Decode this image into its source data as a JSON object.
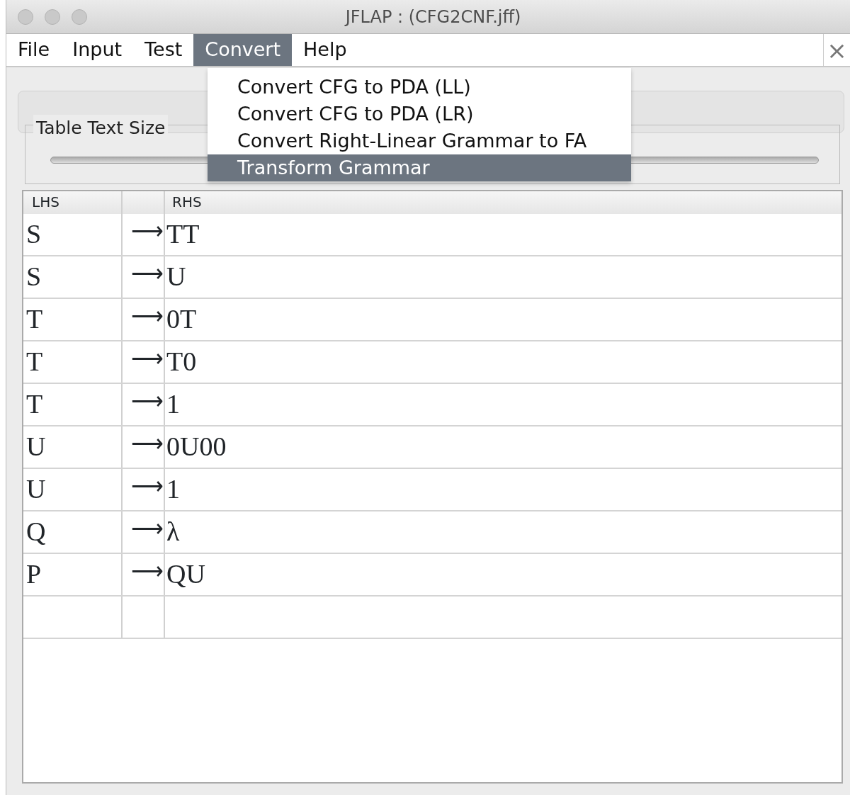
{
  "window": {
    "title": "JFLAP : (CFG2CNF.jff)"
  },
  "menubar": [
    {
      "label": "File",
      "selected": false
    },
    {
      "label": "Input",
      "selected": false
    },
    {
      "label": "Test",
      "selected": false
    },
    {
      "label": "Convert",
      "selected": true
    },
    {
      "label": "Help",
      "selected": false
    }
  ],
  "close_button": "×",
  "dropdown": [
    {
      "label": "Convert CFG to PDA (LL)",
      "selected": false
    },
    {
      "label": "Convert CFG to PDA (LR)",
      "selected": false
    },
    {
      "label": "Convert Right-Linear Grammar to FA",
      "selected": false
    },
    {
      "label": "Transform Grammar",
      "selected": true
    }
  ],
  "text_size": {
    "legend": "Table Text Size"
  },
  "table": {
    "columns": [
      "LHS",
      "RHS"
    ],
    "rows": [
      {
        "lhs": "S",
        "arrow": "⟶",
        "rhs": "TT"
      },
      {
        "lhs": "S",
        "arrow": "⟶",
        "rhs": "U"
      },
      {
        "lhs": "T",
        "arrow": "⟶",
        "rhs": "0T"
      },
      {
        "lhs": "T",
        "arrow": "⟶",
        "rhs": "T0"
      },
      {
        "lhs": "T",
        "arrow": "⟶",
        "rhs": "1"
      },
      {
        "lhs": "U",
        "arrow": "⟶",
        "rhs": "0U00"
      },
      {
        "lhs": "U",
        "arrow": "⟶",
        "rhs": "1"
      },
      {
        "lhs": "Q",
        "arrow": "⟶",
        "rhs": "λ"
      },
      {
        "lhs": "P",
        "arrow": "⟶",
        "rhs": "QU"
      },
      {}
    ]
  }
}
